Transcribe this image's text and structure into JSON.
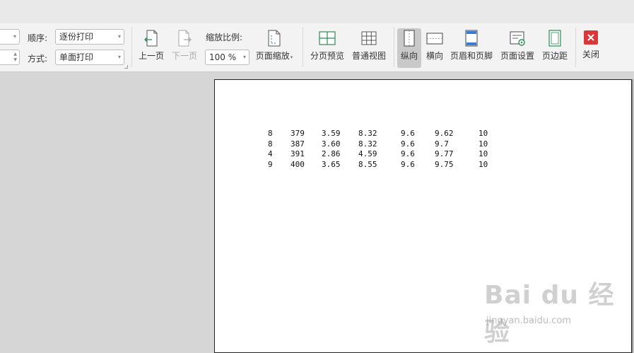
{
  "settings": {
    "order_label": "顺序:",
    "order_value": "逐份打印",
    "mode_label": "方式:",
    "mode_value": "单面打印",
    "zoom_label": "缩放比例:",
    "zoom_value": "100 %"
  },
  "buttons": {
    "prev_page": "上一页",
    "next_page": "下一页",
    "page_zoom": "页面缩放",
    "page_break_preview": "分页预览",
    "normal_view": "普通视图",
    "portrait": "纵向",
    "landscape": "横向",
    "header_footer": "页眉和页脚",
    "page_setup": "页面设置",
    "margins": "页边距",
    "close": "关闭"
  },
  "table_rows": [
    [
      "8",
      "379",
      "3.59",
      "8.32",
      "9.6",
      "9.62",
      "10"
    ],
    [
      "8",
      "387",
      "3.60",
      "8.32",
      "9.6",
      "9.7",
      "10"
    ],
    [
      "4",
      "391",
      "2.86",
      "4.59",
      "9.6",
      "9.77",
      "10"
    ],
    [
      "9",
      "400",
      "3.65",
      "8.55",
      "9.6",
      "9.75",
      "10"
    ]
  ],
  "watermark": {
    "brand": "Bai du 经验",
    "url": "jingyan.baidu.com"
  },
  "colors": {
    "close_icon": "#d9373a",
    "prev_icon_accent": "#2e8b57",
    "active_button": "#c9c9c9"
  }
}
